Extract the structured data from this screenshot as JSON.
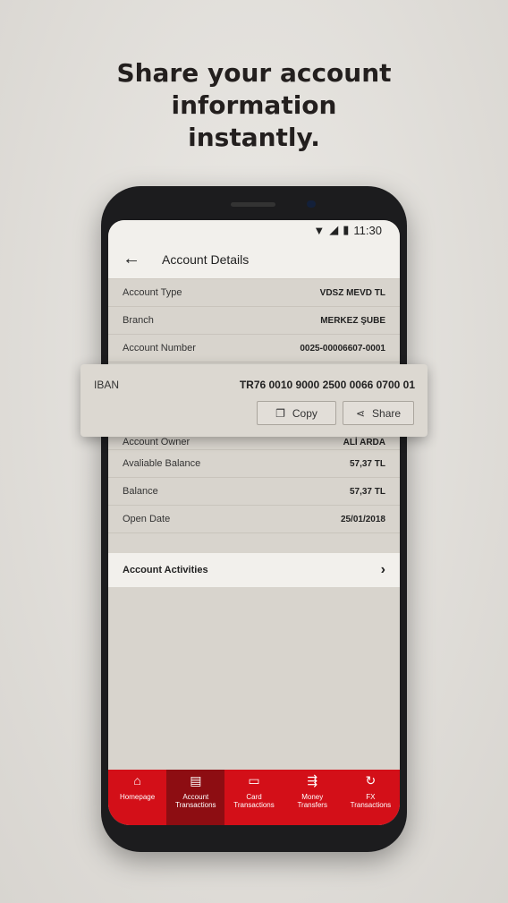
{
  "headline": [
    "Share your account",
    "information",
    "instantly."
  ],
  "status": {
    "time": "11:30"
  },
  "appbar": {
    "title": "Account Details"
  },
  "rows": [
    {
      "label": "Account Type",
      "value": "VDSZ MEVD TL"
    },
    {
      "label": "Branch",
      "value": "MERKEZ ŞUBE"
    },
    {
      "label": "Account Number",
      "value": "0025-00006607-0001"
    }
  ],
  "rows2": [
    {
      "label": "Account Owner",
      "value": "ALİ ARDA"
    },
    {
      "label": "Avaliable Balance",
      "value": "57,37 TL"
    },
    {
      "label": "Balance",
      "value": "57,37 TL"
    },
    {
      "label": "Open Date",
      "value": "25/01/2018"
    }
  ],
  "activities": "Account Activities",
  "iban": {
    "label": "IBAN",
    "value": "TR76 0010 9000 2500 0066 0700 01",
    "copy": "Copy",
    "share": "Share"
  },
  "nav": [
    {
      "l1": "Homepage",
      "l2": ""
    },
    {
      "l1": "Account",
      "l2": "Transactions"
    },
    {
      "l1": "Card",
      "l2": "Transactions"
    },
    {
      "l1": "Money",
      "l2": "Transfers"
    },
    {
      "l1": "FX",
      "l2": "Transactions"
    }
  ],
  "colors": {
    "brand": "#d30f18",
    "active": "#8d0d12"
  }
}
